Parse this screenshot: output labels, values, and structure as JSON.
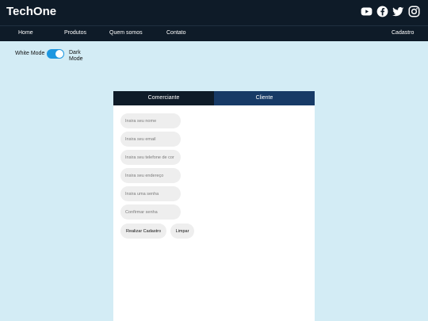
{
  "header": {
    "brand": "TechOne",
    "social_icons": [
      "youtube-icon",
      "facebook-icon",
      "twitter-icon",
      "instagram-icon"
    ]
  },
  "nav": {
    "items": [
      {
        "label": "Home"
      },
      {
        "label": "Produtos"
      },
      {
        "label": "Quem somos"
      },
      {
        "label": "Contato"
      },
      {
        "label": "Cadastro"
      }
    ]
  },
  "theme": {
    "left_label": "White Mode",
    "right_label": "Dark Mode",
    "toggle_state": "on",
    "toggle_color": "#1e97e0"
  },
  "form": {
    "tabs": [
      {
        "label": "Comerciante"
      },
      {
        "label": "Cliente"
      }
    ],
    "fields": [
      {
        "placeholder": "Insira seu nome"
      },
      {
        "placeholder": "Insira seu email"
      },
      {
        "placeholder": "Insira seu telefone de cor"
      },
      {
        "placeholder": "Insira seu endereço"
      },
      {
        "placeholder": "Insira uma senha"
      },
      {
        "placeholder": "Confirmar senha"
      }
    ],
    "submit_label": "Realizar Cadastro",
    "clear_label": "Limpar"
  },
  "colors": {
    "header_bg": "#0e1b28",
    "page_bg": "#d3ecf5",
    "active_tab": "#173a66"
  }
}
